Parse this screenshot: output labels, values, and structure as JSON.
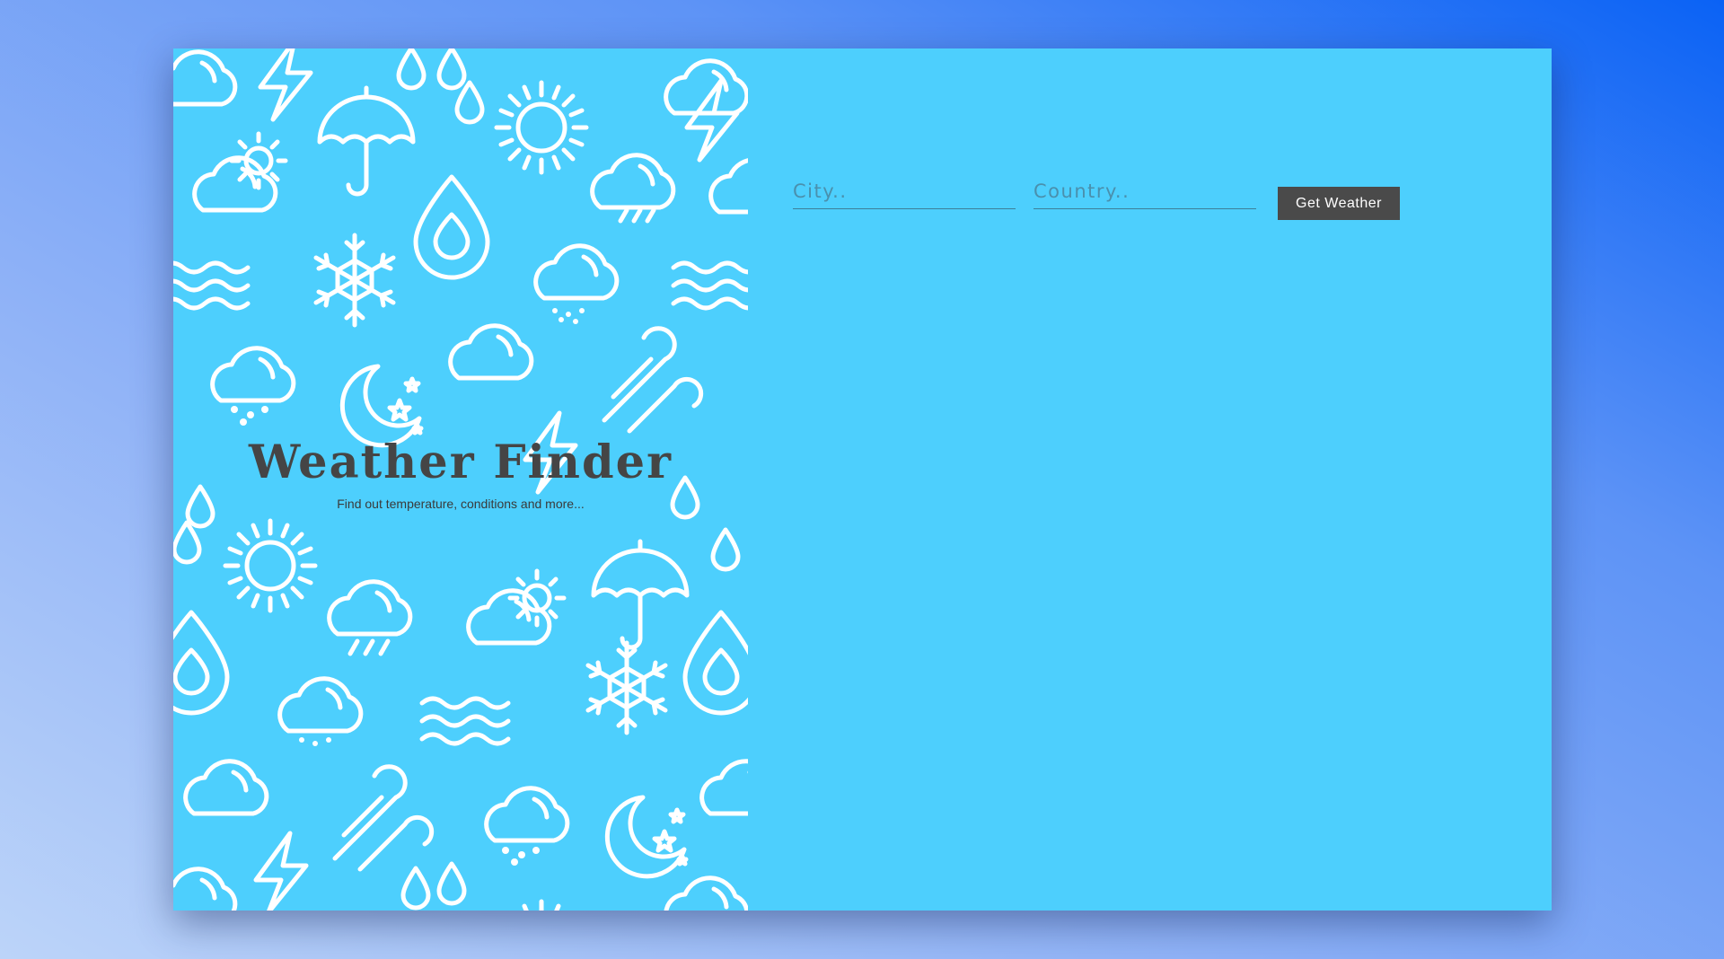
{
  "hero": {
    "title": "Weather Finder",
    "subtitle": "Find out temperature, conditions and more..."
  },
  "form": {
    "city_placeholder": "City..",
    "city_value": "",
    "country_placeholder": "Country..",
    "country_value": "",
    "submit_label": "Get Weather"
  },
  "colors": {
    "page_gradient_start": "#bcd4f9",
    "page_gradient_end": "#0a62f5",
    "card_background": "#4dcffd",
    "button_background": "#4a4a4a",
    "title_text": "#454545"
  },
  "pattern": {
    "icons": [
      "cloud-icon",
      "lightning-icon",
      "raindrop-icon",
      "sun-icon",
      "umbrella-icon",
      "partly-sunny-icon",
      "snowflake-icon",
      "waves-icon",
      "snow-cloud-icon",
      "rain-cloud-icon",
      "moon-stars-icon",
      "wind-icon",
      "cloud-lightning-icon"
    ]
  }
}
